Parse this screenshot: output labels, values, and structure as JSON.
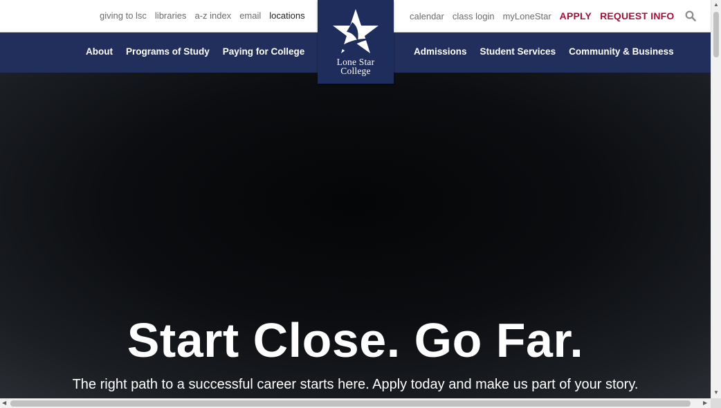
{
  "utility": {
    "left_links": [
      "giving to lsc",
      "libraries",
      "a-z index",
      "email",
      "locations"
    ],
    "right_links": [
      "calendar",
      "class login",
      "myLoneStar"
    ],
    "apply": "APPLY",
    "request_info": "REQUEST INFO",
    "search_icon": "search-icon"
  },
  "logo": {
    "line1": "Lone Star",
    "line2": "College",
    "icon": "star-icon"
  },
  "nav": {
    "left": [
      "About",
      "Programs of Study",
      "Paying for College"
    ],
    "right": [
      "Admissions",
      "Student Services",
      "Community & Business"
    ]
  },
  "hero": {
    "title": "Start Close. Go Far.",
    "subtitle": "The right path to a successful career starts here. Apply today and make us part of your story."
  },
  "colors": {
    "nav_bg": "#222f5c",
    "logo_bg": "#1f2d5c",
    "cta": "#a3103a"
  }
}
